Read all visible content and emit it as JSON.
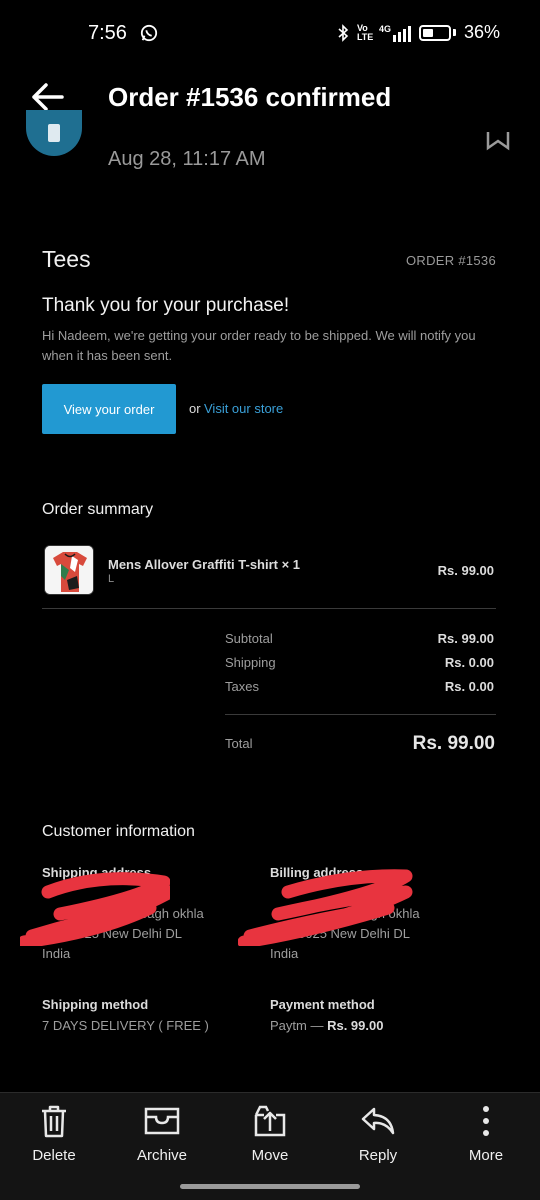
{
  "status_bar": {
    "time": "7:56",
    "network": "Vo LTE",
    "net_type": "4G",
    "battery": "36%"
  },
  "header": {
    "title": "Order #1536 confirmed"
  },
  "email": {
    "date": "Aug 28, 11:17 AM"
  },
  "store": {
    "name": "Tees",
    "order_number": "ORDER #1536"
  },
  "message": {
    "heading": "Thank you for your purchase!",
    "body": "Hi Nadeem, we're getting your order ready to be shipped. We will notify you when it has been sent.",
    "view_order_label": "View your order",
    "or_label": "or",
    "visit_store_label": "Visit our store"
  },
  "order_summary": {
    "title": "Order summary",
    "items": [
      {
        "name": "Mens Allover Graffiti T-shirt × 1",
        "variant": "L",
        "price": "Rs. 99.00"
      }
    ],
    "subtotal_label": "Subtotal",
    "subtotal": "Rs. 99.00",
    "shipping_label": "Shipping",
    "shipping": "Rs. 0.00",
    "taxes_label": "Taxes",
    "taxes": "Rs. 0.00",
    "total_label": "Total",
    "total": "Rs. 99.00"
  },
  "customer": {
    "title": "Customer information",
    "shipping_address_label": "Shipping address",
    "shipping_line2": "en bagh okhla",
    "shipping_line3": "0025 New Delhi DL",
    "shipping_country": "India",
    "billing_address_label": "Billing address",
    "billing_line2": "bagh okhla",
    "billing_line3": "0025 New Delhi DL",
    "billing_country": "India",
    "shipping_method_label": "Shipping method",
    "shipping_method": "7 DAYS DELIVERY ( FREE )",
    "payment_method_label": "Payment method",
    "payment_provider": "Paytm —",
    "payment_amount": "Rs. 99.00"
  },
  "bottom_bar": {
    "delete": "Delete",
    "archive": "Archive",
    "move": "Move",
    "reply": "Reply",
    "more": "More"
  },
  "colors": {
    "accent_button": "#2299d2",
    "link": "#3aa0d8",
    "redaction": "#e8343f"
  }
}
